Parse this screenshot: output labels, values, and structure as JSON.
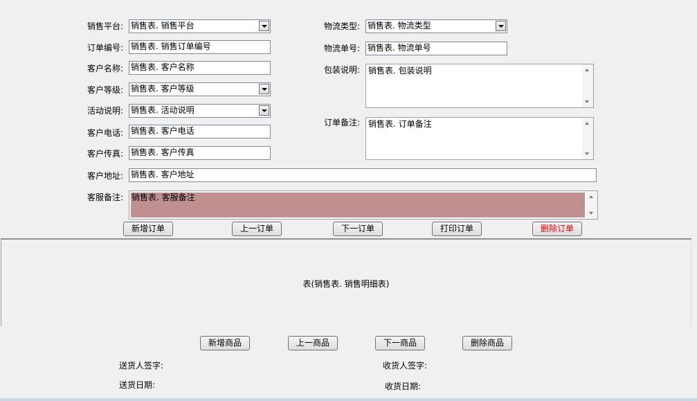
{
  "form": {
    "labels": {
      "platform": "销售平台:",
      "order_no": "订单编号:",
      "customer_name": "客户名称:",
      "customer_level": "客户等级:",
      "activity": "活动说明:",
      "phone": "客户电话:",
      "fax": "客户传真:",
      "address": "客户地址:",
      "service_note": "客服备注:",
      "logistics_type": "物流类型:",
      "logistics_no": "物流单号:",
      "packing": "包装说明:",
      "order_note": "订单备注:"
    },
    "values": {
      "platform": "销售表. 销售平台",
      "order_no": "销售表. 销售订单编号",
      "customer_name": "销售表. 客户名称",
      "customer_level": "销售表. 客户等级",
      "activity": "销售表. 活动说明",
      "phone": "销售表. 客户电话",
      "fax": "销售表. 客户传真",
      "address": "销售表. 客户地址",
      "service_note": "销售表. 客服备注",
      "logistics_type": "销售表. 物流类型",
      "logistics_no": "销售表. 物流单号",
      "packing": "销售表. 包装说明",
      "order_note": "销售表. 订单备注"
    }
  },
  "order_buttons": {
    "new": "新增订单",
    "prev": "上一订单",
    "next": "下一订单",
    "print": "打印订单",
    "delete": "删除订单"
  },
  "detail_table": {
    "label": "表(销售表. 销售明细表)"
  },
  "item_buttons": {
    "new": "新增商品",
    "prev": "上一商品",
    "next": "下一商品",
    "delete": "删除商品"
  },
  "footer": {
    "sender_sign": "送货人签字:",
    "receiver_sign": "收货人签字:",
    "send_date": "送货日期:",
    "receive_date": "收货日期:"
  },
  "colors": {
    "service_note_bg": "#c09090",
    "delete_text": "#e00000"
  }
}
